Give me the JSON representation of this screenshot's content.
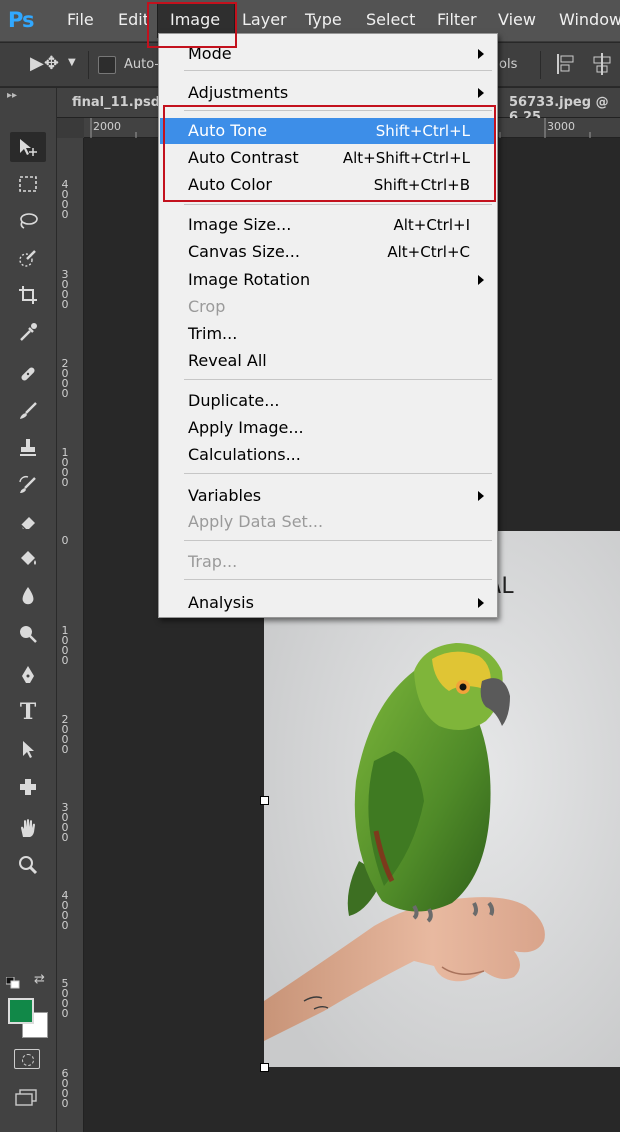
{
  "menubar": {
    "logo": "Ps",
    "items": [
      "File",
      "Edit",
      "Image",
      "Layer",
      "Type",
      "Select",
      "Filter",
      "View",
      "Window"
    ],
    "active": "Image"
  },
  "options_bar": {
    "auto_select_label": "Auto-",
    "controls_label": "ols"
  },
  "tabs": {
    "tab1": "final_11.psd",
    "tab2": "56733.jpeg @ 6,25"
  },
  "ruler_top": [
    "2000",
    "3000"
  ],
  "ruler_left": [
    "4000",
    "3000",
    "2000",
    "1000",
    "0",
    "1000",
    "2000",
    "3000",
    "4000",
    "5000",
    "6000"
  ],
  "canvas": {
    "image_text_fragment": "AL"
  },
  "image_menu": {
    "items": [
      {
        "label": "Mode",
        "shortcut": "",
        "submenu": true
      },
      {
        "label": "Adjustments",
        "shortcut": "",
        "submenu": true
      },
      {
        "label": "Auto Tone",
        "shortcut": "Shift+Ctrl+L",
        "selected": true
      },
      {
        "label": "Auto Contrast",
        "shortcut": "Alt+Shift+Ctrl+L"
      },
      {
        "label": "Auto Color",
        "shortcut": "Shift+Ctrl+B"
      },
      {
        "label": "Image Size...",
        "shortcut": "Alt+Ctrl+I"
      },
      {
        "label": "Canvas Size...",
        "shortcut": "Alt+Ctrl+C"
      },
      {
        "label": "Image Rotation",
        "shortcut": "",
        "submenu": true
      },
      {
        "label": "Crop",
        "shortcut": "",
        "disabled": true
      },
      {
        "label": "Trim...",
        "shortcut": ""
      },
      {
        "label": "Reveal All",
        "shortcut": ""
      },
      {
        "label": "Duplicate...",
        "shortcut": ""
      },
      {
        "label": "Apply Image...",
        "shortcut": ""
      },
      {
        "label": "Calculations...",
        "shortcut": ""
      },
      {
        "label": "Variables",
        "shortcut": "",
        "submenu": true
      },
      {
        "label": "Apply Data Set...",
        "shortcut": "",
        "disabled": true
      },
      {
        "label": "Trap...",
        "shortcut": "",
        "disabled": true
      },
      {
        "label": "Analysis",
        "shortcut": "",
        "submenu": true
      }
    ]
  },
  "colors": {
    "foreground": "#118848",
    "background": "#ffffff",
    "highlight": "#3d8ee8",
    "annotation": "#c3111d"
  }
}
